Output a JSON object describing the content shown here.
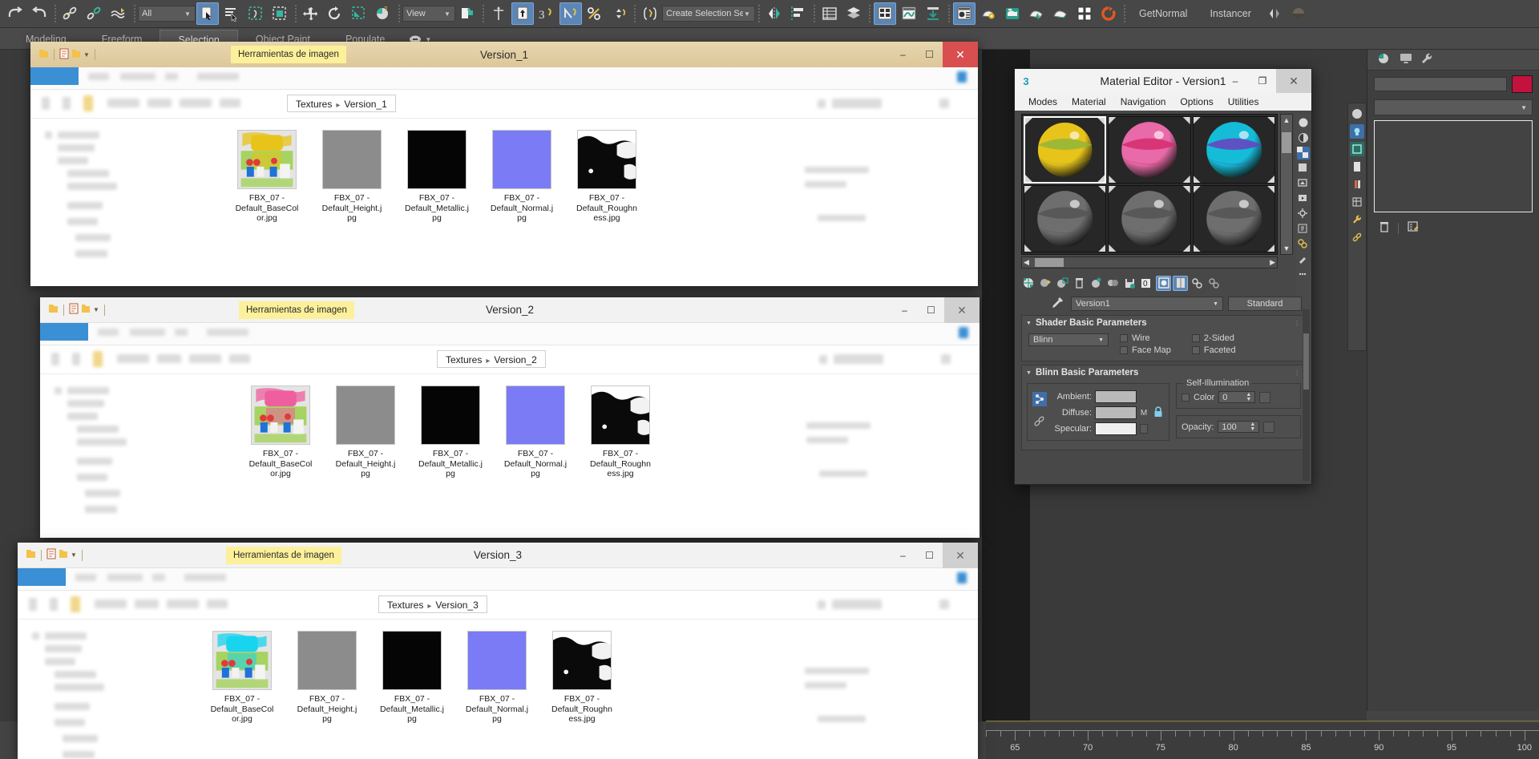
{
  "app": {
    "toolbar": {
      "selection_filter": "All",
      "reference_coord": "View",
      "named_selection_placeholder": "Create Selection Se",
      "scripts": [
        "GetNormal",
        "Instancer"
      ],
      "icons": [
        "undo-icon",
        "redo-icon",
        "select-link-icon",
        "unlink-icon",
        "bind-space-warp-icon",
        "select-object-icon",
        "select-by-name-icon",
        "select-region-icon",
        "window-crossing-icon",
        "select-move-icon",
        "select-rotate-icon",
        "select-scale-icon",
        "placement-icon",
        "use-center-icon",
        "select-manipulate-icon",
        "snap-toggle-icon",
        "angle-snap-icon",
        "percent-snap-icon",
        "spinner-snap-icon",
        "edit-named-selection-icon",
        "mirror-icon",
        "align-icon",
        "layer-manager-icon",
        "scene-explorer-icon",
        "ribbon-icon",
        "curve-editor-icon",
        "schematic-view-icon",
        "material-editor-icon",
        "render-setup-icon",
        "rendered-frame-icon",
        "render-production-icon",
        "render-iterative-icon",
        "adt-icon",
        "project-folder-icon"
      ]
    },
    "ribbon_tabs": [
      {
        "label": "Modeling",
        "selected": false
      },
      {
        "label": "Freeform",
        "selected": false
      },
      {
        "label": "Selection",
        "selected": true
      },
      {
        "label": "Object Paint",
        "selected": false
      },
      {
        "label": "Populate",
        "selected": false
      }
    ],
    "timeline": {
      "ticks": [
        65,
        70,
        75,
        80,
        85,
        90,
        95,
        100
      ],
      "min": 63,
      "max": 101
    },
    "command_panel": {
      "tabs": [
        "create-icon",
        "modify-icon",
        "utilities-icon"
      ],
      "color_swatch": "#c4123f"
    }
  },
  "material_editor": {
    "slot_number": "3",
    "title": "Material Editor - Version1",
    "menu": [
      "Modes",
      "Material",
      "Navigation",
      "Options",
      "Utilities"
    ],
    "window_controls": {
      "minimize": "–",
      "maximize": "❐",
      "close": "✕"
    },
    "slots": [
      {
        "name": "slot-1",
        "color": "#e8c31a",
        "accent": "#8fb63a",
        "selected": true
      },
      {
        "name": "slot-2",
        "color": "#e86aa8",
        "accent": "#d52b6e",
        "selected": false
      },
      {
        "name": "slot-3",
        "color": "#14bcd8",
        "accent": "#6b3fc0",
        "selected": false
      },
      {
        "name": "slot-4",
        "color": "#6e6e6e",
        "accent": "#555555",
        "selected": false
      },
      {
        "name": "slot-5",
        "color": "#6e6e6e",
        "accent": "#555555",
        "selected": false
      },
      {
        "name": "slot-6",
        "color": "#6e6e6e",
        "accent": "#555555",
        "selected": false
      }
    ],
    "material_name": "Version1",
    "material_type": "Standard",
    "shader_basic": {
      "header": "Shader Basic Parameters",
      "shader": "Blinn",
      "checkboxes": [
        {
          "label": "Wire",
          "checked": false
        },
        {
          "label": "2-Sided",
          "checked": false
        },
        {
          "label": "Face Map",
          "checked": false
        },
        {
          "label": "Faceted",
          "checked": false
        }
      ]
    },
    "blinn_basic": {
      "header": "Blinn Basic Parameters",
      "ambient_label": "Ambient:",
      "diffuse_label": "Diffuse:",
      "specular_label": "Specular:",
      "ambient_color": "#b9b9b9",
      "diffuse_color": "#b9b9b9",
      "specular_color": "#efefef",
      "map_letter": "M",
      "self_illumination": {
        "group_label": "Self-Illumination",
        "color_label": "Color",
        "value": "0"
      },
      "opacity": {
        "label": "Opacity:",
        "value": "100"
      }
    }
  },
  "explorer_windows": [
    {
      "title": "Version_1",
      "ribbon_tag": "Herramientas de imagen",
      "active": true,
      "breadcrumb": [
        "Textures",
        "Version_1"
      ],
      "files": [
        {
          "name": "FBX_07 - Default_BaseColor.jpg",
          "kind": "basecolor",
          "color": "#e8c31a"
        },
        {
          "name": "FBX_07 - Default_Height.jpg",
          "kind": "flat",
          "color": "#8c8c8c"
        },
        {
          "name": "FBX_07 - Default_Metallic.jpg",
          "kind": "flat",
          "color": "#050505"
        },
        {
          "name": "FBX_07 - Default_Normal.jpg",
          "kind": "flat",
          "color": "#7b7bf5"
        },
        {
          "name": "FBX_07 - Default_Roughness.jpg",
          "kind": "rough",
          "color": "#0a0a0a"
        }
      ]
    },
    {
      "title": "Version_2",
      "ribbon_tag": "Herramientas de imagen",
      "active": false,
      "breadcrumb": [
        "Textures",
        "Version_2"
      ],
      "files": [
        {
          "name": "FBX_07 - Default_BaseColor.jpg",
          "kind": "basecolor",
          "color": "#ef5fa0"
        },
        {
          "name": "FBX_07 - Default_Height.jpg",
          "kind": "flat",
          "color": "#8c8c8c"
        },
        {
          "name": "FBX_07 - Default_Metallic.jpg",
          "kind": "flat",
          "color": "#050505"
        },
        {
          "name": "FBX_07 - Default_Normal.jpg",
          "kind": "flat",
          "color": "#7b7bf5"
        },
        {
          "name": "FBX_07 - Default_Roughness.jpg",
          "kind": "rough",
          "color": "#0a0a0a"
        }
      ]
    },
    {
      "title": "Version_3",
      "ribbon_tag": "Herramientas de imagen",
      "active": false,
      "breadcrumb": [
        "Textures",
        "Version_3"
      ],
      "files": [
        {
          "name": "FBX_07 - Default_BaseColor.jpg",
          "kind": "basecolor",
          "color": "#19d4ef"
        },
        {
          "name": "FBX_07 - Default_Height.jpg",
          "kind": "flat",
          "color": "#8c8c8c"
        },
        {
          "name": "FBX_07 - Default_Metallic.jpg",
          "kind": "flat",
          "color": "#050505"
        },
        {
          "name": "FBX_07 - Default_Normal.jpg",
          "kind": "flat",
          "color": "#7b7bf5"
        },
        {
          "name": "FBX_07 - Default_Roughness.jpg",
          "kind": "rough",
          "color": "#0a0a0a"
        }
      ]
    }
  ]
}
